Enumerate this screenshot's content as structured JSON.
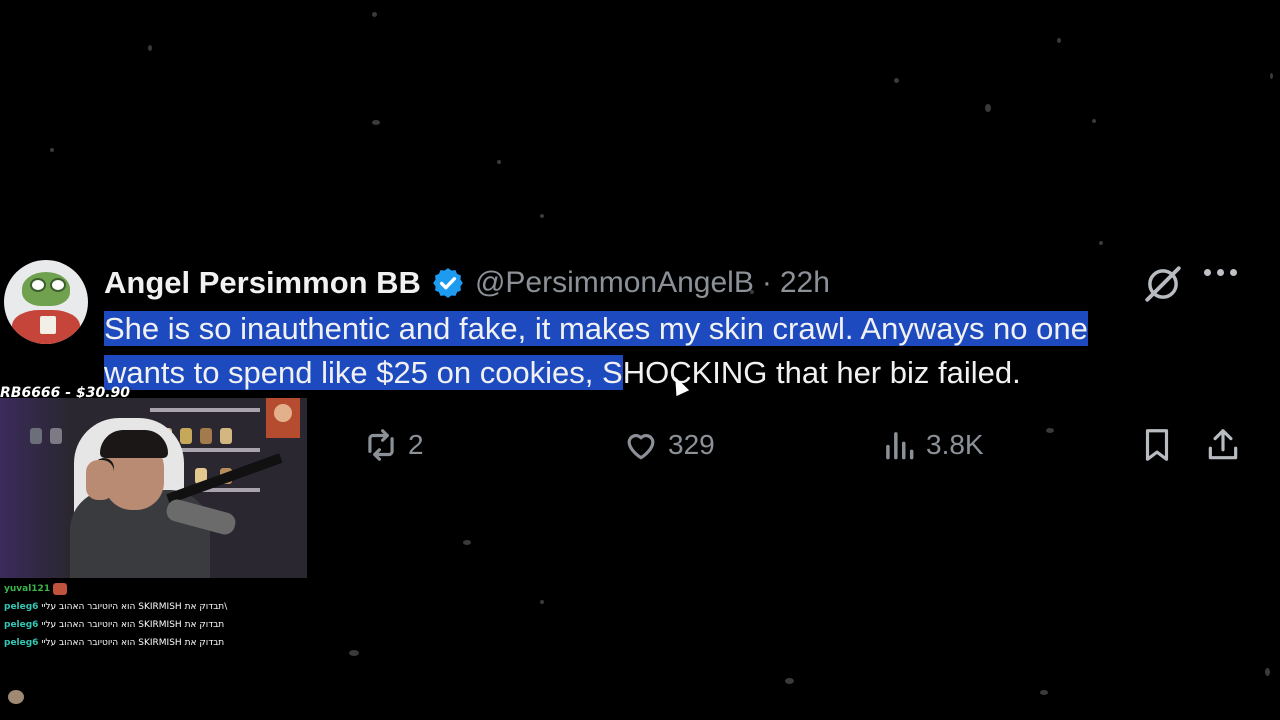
{
  "tweet": {
    "author_name": "Angel Persimmon BB",
    "handle": "@PersimmonAngelB",
    "separator": "·",
    "time": "22h",
    "text_line1": "She is so inauthentic and fake, it makes my skin crawl. Anyways no one",
    "text_line2_selected": "wants to spend like $25 on cookies, S",
    "text_line2_rest": "HOCKING that her biz failed.",
    "icons": [
      "verified-badge-icon",
      "grok-icon",
      "more-icon",
      "reply-icon",
      "retweet-icon",
      "like-icon",
      "views-icon",
      "bookmark-icon",
      "share-icon"
    ],
    "retweets": "2",
    "likes": "329",
    "views": "3.8K"
  },
  "stream": {
    "donation": "RB6666 - $30.90",
    "chat": [
      {
        "user": "yuval121",
        "message": ""
      },
      {
        "user": "peleg6",
        "message": "הוא היוטיובר האהוב עליי SKIRMISH תבדוק את\\"
      },
      {
        "user": "peleg6",
        "message": "הוא היוטיובר האהוב עליי SKIRMISH תבדוק את"
      },
      {
        "user": "peleg6",
        "message": "הוא היוטיובר האהוב עליי SKIRMISH תבדוק את"
      }
    ]
  },
  "colors": {
    "background": "#000000",
    "selection": "#1d4bbf",
    "verified": "#1d9bf0",
    "muted": "#8b9197"
  }
}
